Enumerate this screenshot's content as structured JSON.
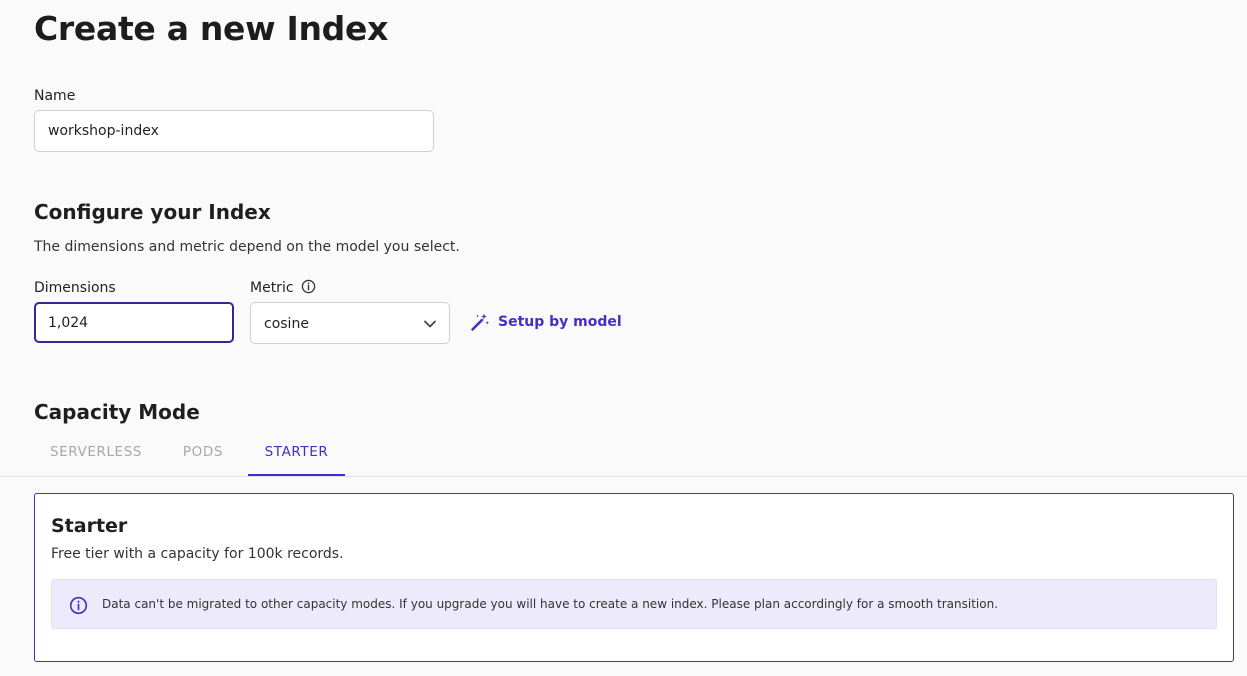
{
  "page": {
    "title": "Create a new Index"
  },
  "name_field": {
    "label": "Name",
    "value": "workshop-index"
  },
  "configure": {
    "title": "Configure your Index",
    "description": "The dimensions and metric depend on the model you select.",
    "dimensions": {
      "label": "Dimensions",
      "value": "1,024"
    },
    "metric": {
      "label": "Metric",
      "value": "cosine",
      "info_icon": "info-circle-icon",
      "chevron_icon": "chevron-down-icon"
    },
    "setup_button": {
      "label": "Setup by model",
      "icon": "magic-wand-icon"
    }
  },
  "capacity": {
    "title": "Capacity Mode",
    "tabs": [
      {
        "label": "SERVERLESS",
        "active": false
      },
      {
        "label": "PODS",
        "active": false
      },
      {
        "label": "STARTER",
        "active": true
      }
    ],
    "panel": {
      "title": "Starter",
      "description": "Free tier with a capacity for 100k records.",
      "notice": "Data can't be migrated to other capacity modes. If you upgrade you will have to create a new index. Please plan accordingly for a smooth transition.",
      "notice_icon": "info-circle-icon"
    }
  },
  "colors": {
    "accent": "#4a2bc9",
    "focus_border": "#3b2391",
    "notice_background": "#edeafb",
    "page_background": "#fafafa"
  }
}
